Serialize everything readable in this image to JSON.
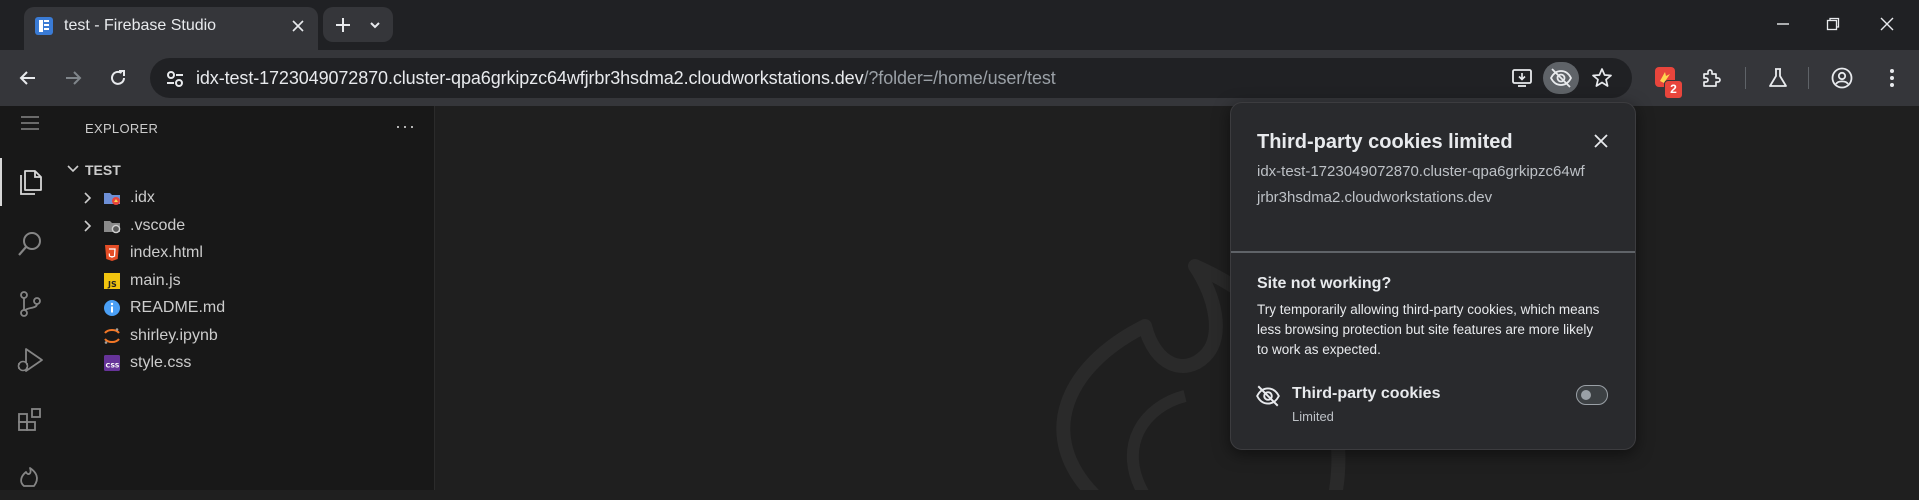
{
  "browser": {
    "tab_title": "test - Firebase Studio",
    "url_host": "idx-test-1723049072870.cluster-qpa6grkipzc64wfjrbr3hsdma2.cloudworkstations.dev",
    "url_path": "/?folder=/home/user/test",
    "extension_badge": "2",
    "icons": {
      "favicon": "firebase-studio-icon",
      "close": "close-icon",
      "new_tab": "plus-icon",
      "tab_search": "chevron-down-icon",
      "minimize": "minimize-icon",
      "restore": "restore-icon",
      "window_close": "close-icon",
      "back": "arrow-left-icon",
      "forward": "arrow-right-icon",
      "reload": "reload-icon",
      "site_info": "tune-icon",
      "install": "install-app-icon",
      "cookies": "eye-off-icon",
      "bookmark": "star-icon",
      "extensions": "puzzle-icon",
      "labs": "flask-icon",
      "profile": "account-icon",
      "menu": "more-vert-icon"
    }
  },
  "vscode": {
    "explorer_title": "EXPLORER",
    "more_label": "···",
    "folder": "TEST",
    "tree": [
      {
        "name": ".idx",
        "kind": "folder",
        "icon": "idx-folder-icon"
      },
      {
        "name": ".vscode",
        "kind": "folder",
        "icon": "vscode-folder-icon"
      },
      {
        "name": "index.html",
        "kind": "file",
        "icon": "html-file-icon"
      },
      {
        "name": "main.js",
        "kind": "file",
        "icon": "js-file-icon"
      },
      {
        "name": "README.md",
        "kind": "file",
        "icon": "info-file-icon"
      },
      {
        "name": "shirley.ipynb",
        "kind": "file",
        "icon": "jupyter-file-icon"
      },
      {
        "name": "style.css",
        "kind": "file",
        "icon": "css-file-icon"
      }
    ],
    "activity_icons": [
      "menu-icon",
      "files-icon",
      "search-icon",
      "source-control-icon",
      "run-debug-icon",
      "extensions-icon",
      "firebase-icon"
    ]
  },
  "cookie_popup": {
    "title": "Third-party cookies limited",
    "host": "idx-test-1723049072870.cluster-qpa6grkipzc64wfjrbr3hsdma2.cloudworkstations.dev",
    "question": "Site not working?",
    "description": "Try temporarily allowing third-party cookies, which means less browsing protection but site features are more likely to work as expected.",
    "setting_label": "Third-party cookies",
    "setting_status": "Limited",
    "toggle_on": false
  },
  "colors": {
    "accent_badge": "#e8453c",
    "editor_bg": "#1f1f1f",
    "chrome_bg": "#202124"
  }
}
